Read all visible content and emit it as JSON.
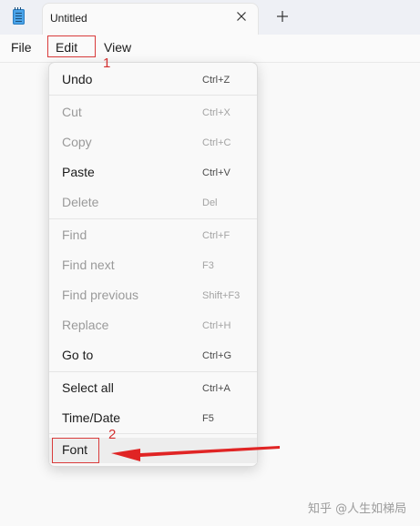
{
  "tab": {
    "title": "Untitled"
  },
  "menubar": {
    "file": "File",
    "edit": "Edit",
    "view": "View"
  },
  "edit_menu": {
    "items": [
      {
        "label": "Undo",
        "shortcut": "Ctrl+Z",
        "enabled": true
      },
      {
        "label": "Cut",
        "shortcut": "Ctrl+X",
        "enabled": false
      },
      {
        "label": "Copy",
        "shortcut": "Ctrl+C",
        "enabled": false
      },
      {
        "label": "Paste",
        "shortcut": "Ctrl+V",
        "enabled": true
      },
      {
        "label": "Delete",
        "shortcut": "Del",
        "enabled": false
      },
      {
        "label": "Find",
        "shortcut": "Ctrl+F",
        "enabled": false
      },
      {
        "label": "Find next",
        "shortcut": "F3",
        "enabled": false
      },
      {
        "label": "Find previous",
        "shortcut": "Shift+F3",
        "enabled": false
      },
      {
        "label": "Replace",
        "shortcut": "Ctrl+H",
        "enabled": false
      },
      {
        "label": "Go to",
        "shortcut": "Ctrl+G",
        "enabled": true
      },
      {
        "label": "Select all",
        "shortcut": "Ctrl+A",
        "enabled": true
      },
      {
        "label": "Time/Date",
        "shortcut": "F5",
        "enabled": true
      },
      {
        "label": "Font",
        "shortcut": "",
        "enabled": true
      }
    ]
  },
  "annotations": {
    "step1": "1",
    "step2": "2",
    "color": "#d93b3b"
  },
  "icons": {
    "app": "notepad-icon",
    "close": "close-icon",
    "new_tab": "plus-icon"
  },
  "watermark": "知乎 @人生如梯局"
}
